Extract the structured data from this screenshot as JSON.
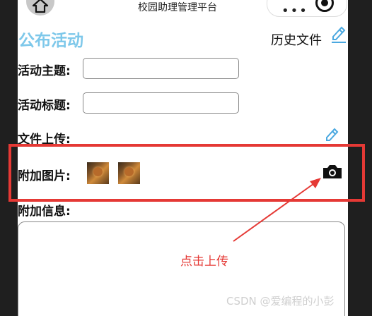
{
  "nav": {
    "title": "校园助理管理平台"
  },
  "page": {
    "title": "公布活动",
    "history_label": "历史文件"
  },
  "form": {
    "theme_label": "活动主题:",
    "title_label": "活动标题:",
    "upload_label": "文件上传:",
    "images_label": "附加图片:",
    "extra_label": "附加信息:",
    "theme_value": "",
    "title_value": "",
    "extra_value": ""
  },
  "annotation": {
    "text": "点击上传",
    "color": "#e53935"
  },
  "watermark": "CSDN @爱编程的小彭",
  "colors": {
    "title": "#7ec8ea",
    "edit_icon": "#4aa8e0"
  },
  "icons": [
    "home-icon",
    "more-icon",
    "close-target-icon",
    "edit-icon",
    "camera-icon"
  ]
}
